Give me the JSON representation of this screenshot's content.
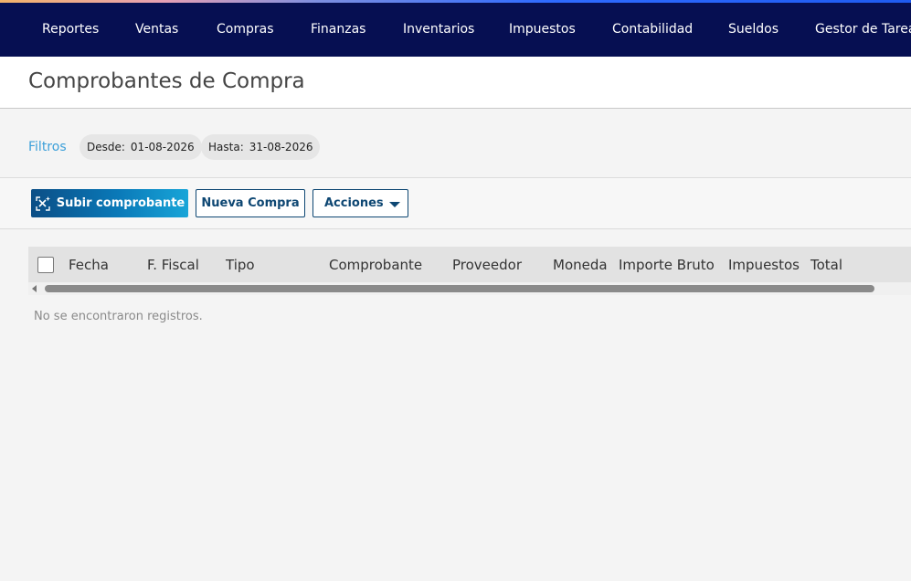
{
  "nav": {
    "items": [
      {
        "label": "Reportes"
      },
      {
        "label": "Ventas"
      },
      {
        "label": "Compras"
      },
      {
        "label": "Finanzas"
      },
      {
        "label": "Inventarios"
      },
      {
        "label": "Impuestos"
      },
      {
        "label": "Contabilidad"
      },
      {
        "label": "Sueldos"
      },
      {
        "label": "Gestor de Tarea"
      }
    ]
  },
  "page": {
    "title": "Comprobantes de Compra"
  },
  "filters": {
    "label": "Filtros",
    "desde": {
      "label": "Desde:",
      "value": "01-08-2026"
    },
    "hasta": {
      "label": "Hasta:",
      "value": "31-08-2026"
    }
  },
  "toolbar": {
    "upload_label": "Subir comprobante",
    "upload_icon": "ai-sparkle-icon",
    "new_label": "Nueva Compra",
    "actions_label": "Acciones"
  },
  "table": {
    "columns": [
      "Fecha",
      "F. Fiscal",
      "Tipo",
      "Comprobante",
      "Proveedor",
      "Moneda",
      "Importe Bruto",
      "Impuestos",
      "Total"
    ],
    "empty_message": "No se encontraron registros."
  },
  "colors": {
    "nav_bg": "#060f52",
    "accent": "#3b9fd9",
    "primary_button": "#0a79b8"
  }
}
